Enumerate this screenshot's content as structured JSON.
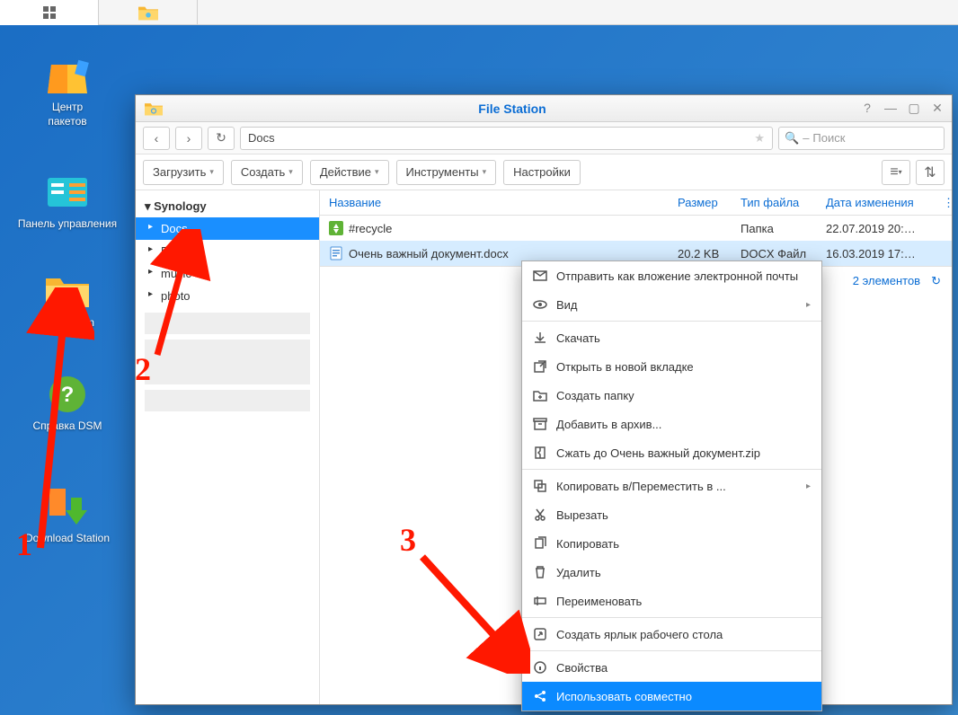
{
  "taskbar": {
    "items": [
      "apps",
      "file-station"
    ]
  },
  "desktop": {
    "icons": [
      {
        "key": "pkg",
        "label": "Центр\nпакетов"
      },
      {
        "key": "ctrl",
        "label": "Панель управления"
      },
      {
        "key": "fs",
        "label": "File Station"
      },
      {
        "key": "help",
        "label": "Справка DSM"
      },
      {
        "key": "dl",
        "label": "Download Station"
      }
    ]
  },
  "window": {
    "title": "File Station",
    "path": "Docs",
    "search_placeholder": "Поиск",
    "toolbar": {
      "upload": "Загрузить",
      "create": "Создать",
      "action": "Действие",
      "tools": "Инструменты",
      "settings": "Настройки"
    },
    "tree": {
      "root": "Synology",
      "items": [
        "Docs",
        "Films",
        "music",
        "photo"
      ]
    },
    "columns": {
      "name": "Название",
      "size": "Размер",
      "type": "Тип файла",
      "date": "Дата изменения"
    },
    "rows": [
      {
        "name": "#recycle",
        "size": "",
        "type": "Папка",
        "date": "22.07.2019 20:…",
        "icon": "recycle"
      },
      {
        "name": "Очень важный документ.docx",
        "size": "20.2 KB",
        "type": "DOCX Файл",
        "date": "16.03.2019 17:…",
        "icon": "docx"
      }
    ],
    "status": {
      "count": "2 элементов"
    }
  },
  "context_menu": {
    "items": [
      {
        "icon": "mail",
        "label": "Отправить как вложение электронной почты"
      },
      {
        "icon": "eye",
        "label": "Вид",
        "caret": true
      },
      {
        "sep": true
      },
      {
        "icon": "download",
        "label": "Скачать"
      },
      {
        "icon": "newtab",
        "label": "Открыть в новой вкладке"
      },
      {
        "icon": "newfolder",
        "label": "Создать папку"
      },
      {
        "icon": "archive",
        "label": "Добавить в архив..."
      },
      {
        "icon": "zip",
        "label": "Сжать до Очень важный документ.zip"
      },
      {
        "sep": true
      },
      {
        "icon": "copymove",
        "label": "Копировать в/Переместить в ...",
        "caret": true
      },
      {
        "icon": "cut",
        "label": "Вырезать"
      },
      {
        "icon": "copy",
        "label": "Копировать"
      },
      {
        "icon": "trash",
        "label": "Удалить"
      },
      {
        "icon": "rename",
        "label": "Переименовать"
      },
      {
        "sep": true
      },
      {
        "icon": "shortcut",
        "label": "Создать ярлык рабочего стола"
      },
      {
        "sep": true
      },
      {
        "icon": "info",
        "label": "Свойства"
      },
      {
        "icon": "share",
        "label": "Использовать совместно",
        "selected": true
      }
    ]
  },
  "annotations": {
    "n1": "1",
    "n2": "2",
    "n3": "3"
  }
}
